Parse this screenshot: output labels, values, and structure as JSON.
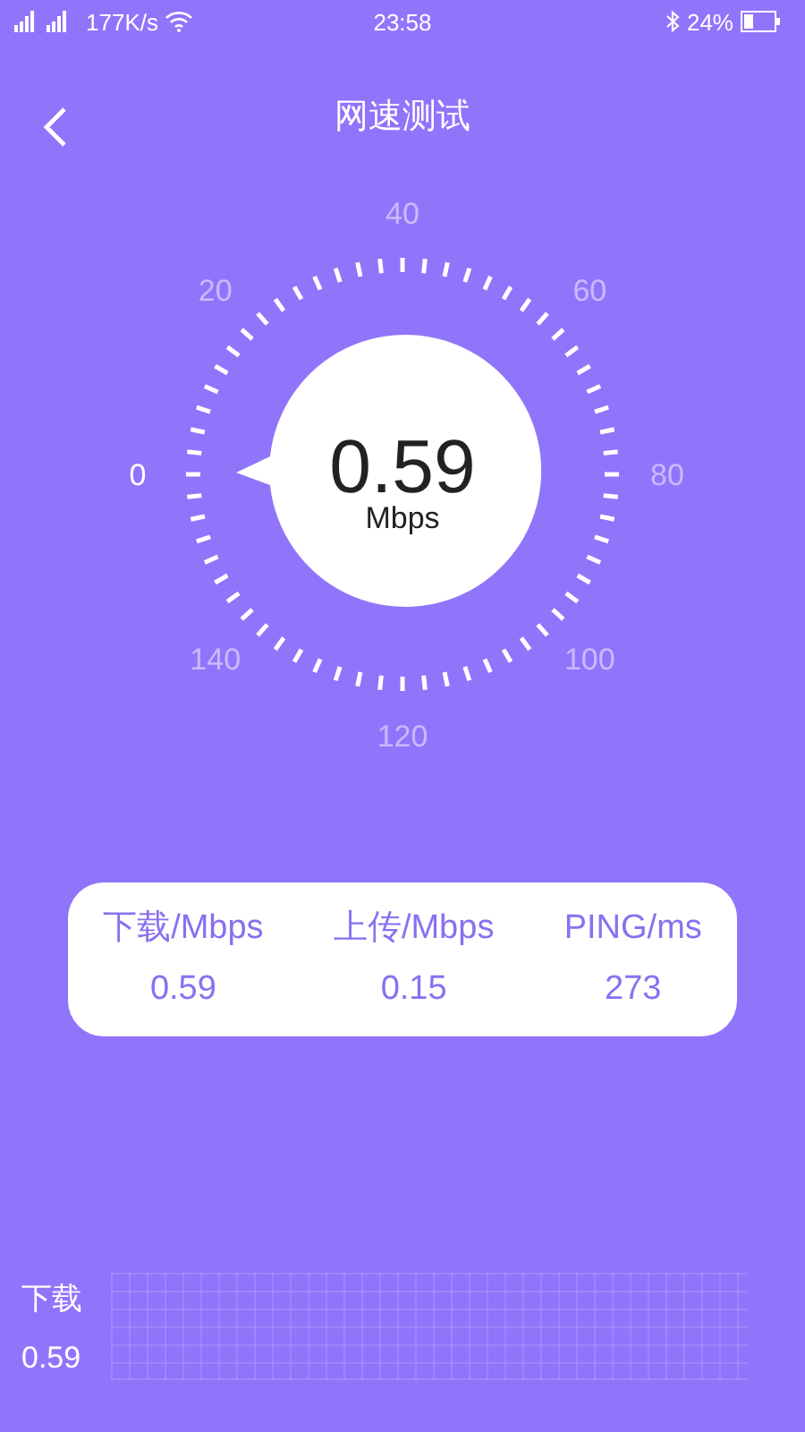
{
  "status_bar": {
    "speed": "177K/s",
    "time": "23:58",
    "battery": "24%"
  },
  "header": {
    "title": "网速测试"
  },
  "gauge": {
    "value": "0.59",
    "unit": "Mbps",
    "labels": [
      {
        "text": "0",
        "selected": true
      },
      {
        "text": "20",
        "selected": false
      },
      {
        "text": "40",
        "selected": false
      },
      {
        "text": "60",
        "selected": false
      },
      {
        "text": "80",
        "selected": false
      },
      {
        "text": "100",
        "selected": false
      },
      {
        "text": "120",
        "selected": false
      },
      {
        "text": "140",
        "selected": false
      }
    ]
  },
  "results": [
    {
      "label": "下载/Mbps",
      "value": "0.59"
    },
    {
      "label": "上传/Mbps",
      "value": "0.15"
    },
    {
      "label": "PING/ms",
      "value": "273"
    }
  ],
  "graph": {
    "label": "下载",
    "value": "0.59"
  }
}
